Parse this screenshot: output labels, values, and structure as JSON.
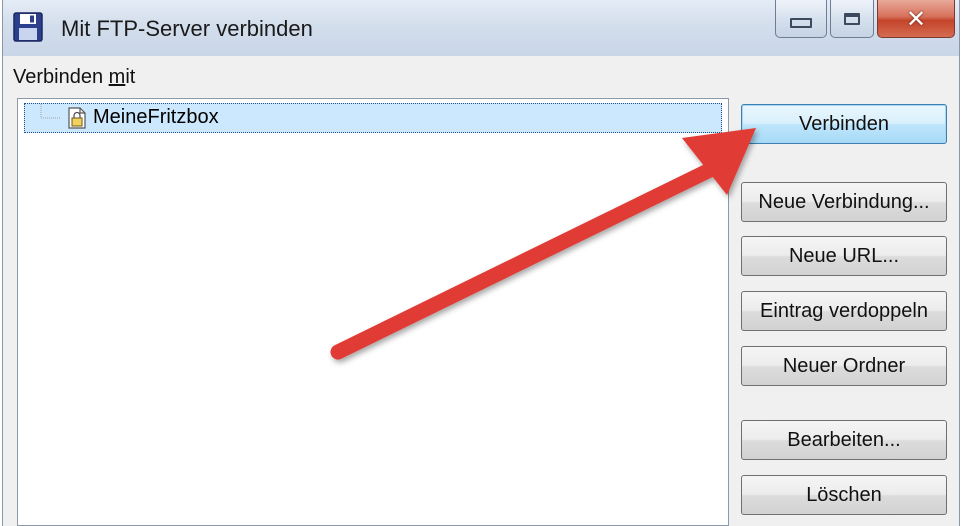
{
  "window": {
    "title": "Mit FTP-Server verbinden",
    "icon": "floppy-disk-icon",
    "caption_buttons": [
      "minimize-icon",
      "maximize-icon",
      "close-icon"
    ]
  },
  "connect_label": {
    "prefix": "Verbinden ",
    "mnemonic": "m",
    "suffix": "it"
  },
  "tree": {
    "items": [
      {
        "label": "MeineFritzbox",
        "icon": "ftp-entry-icon",
        "selected": true
      }
    ]
  },
  "buttons": {
    "connect": "Verbinden",
    "new_connection": "Neue Verbindung...",
    "new_url": "Neue URL...",
    "duplicate": "Eintrag verdoppeln",
    "new_folder": "Neuer Ordner",
    "edit": "Bearbeiten...",
    "delete": "Löschen"
  },
  "colors": {
    "annotation_arrow": "#e03a36",
    "selection": "#cce8ff",
    "default_button": "#bee6fd"
  }
}
